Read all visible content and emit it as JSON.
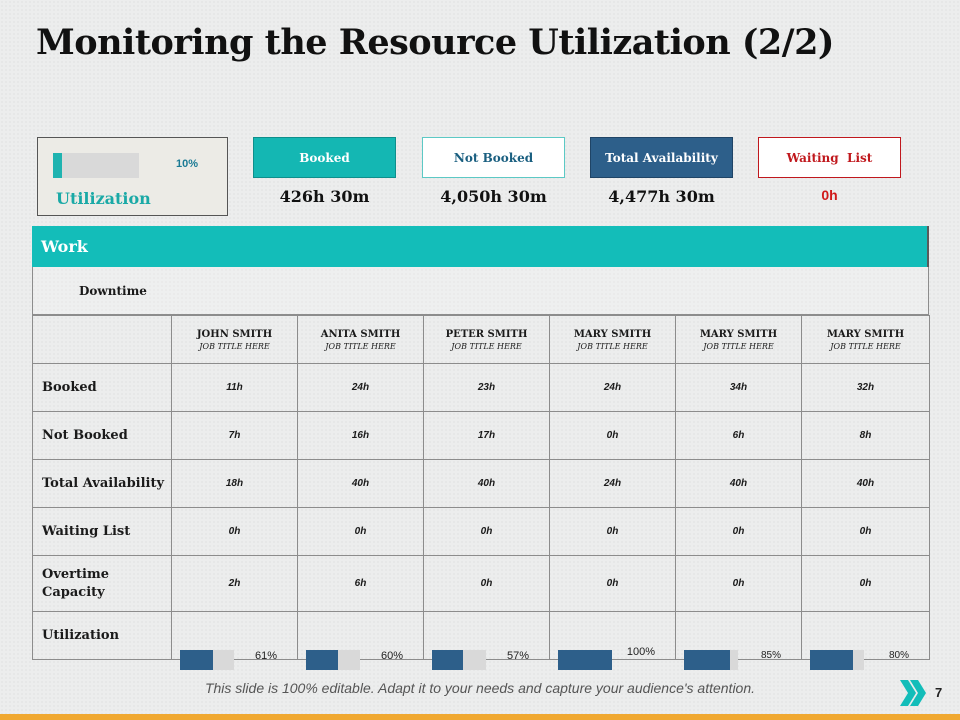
{
  "title": "Monitoring the Resource Utilization (2/2)",
  "summary": {
    "utilization": {
      "label": "Utilization",
      "percent_text": "10%",
      "fraction": 0.1
    },
    "booked": {
      "label": "Booked",
      "value": "426h 30m"
    },
    "not_booked": {
      "label": "Not Booked",
      "value": "4,050h 30m"
    },
    "total_availability": {
      "label": "Total Availability",
      "value": "4,477h 30m"
    },
    "waiting_list": {
      "label": "Waiting  List",
      "value": "0h"
    }
  },
  "table": {
    "section_label": "Work",
    "downtime_label": "Downtime",
    "people": [
      {
        "name": "JOHN SMITH",
        "job": "JOB TITLE HERE"
      },
      {
        "name": "ANITA SMITH",
        "job": "JOB TITLE HERE"
      },
      {
        "name": "PETER SMITH",
        "job": "JOB TITLE HERE"
      },
      {
        "name": "MARY SMITH",
        "job": "JOB TITLE HERE"
      },
      {
        "name": "MARY SMITH",
        "job": "JOB TITLE HERE"
      },
      {
        "name": "MARY SMITH",
        "job": "JOB TITLE HERE"
      }
    ],
    "rows": [
      {
        "label": "Booked",
        "values": [
          "11h",
          "24h",
          "23h",
          "24h",
          "34h",
          "32h"
        ]
      },
      {
        "label": "Not Booked",
        "values": [
          "7h",
          "16h",
          "17h",
          "0h",
          "6h",
          "8h"
        ]
      },
      {
        "label": "Total Availability",
        "values": [
          "18h",
          "40h",
          "40h",
          "24h",
          "40h",
          "40h"
        ]
      },
      {
        "label": "Waiting List",
        "values": [
          "0h",
          "0h",
          "0h",
          "0h",
          "0h",
          "0h"
        ]
      },
      {
        "label": "Overtime Capacity",
        "values": [
          "2h",
          "6h",
          "0h",
          "0h",
          "0h",
          "0h"
        ]
      }
    ],
    "utilization": {
      "label": "Utilization",
      "items": [
        {
          "text": "61%",
          "fraction": 0.61
        },
        {
          "text": "60%",
          "fraction": 0.6
        },
        {
          "text": "57%",
          "fraction": 0.57
        },
        {
          "text": "100%",
          "fraction": 1.0
        },
        {
          "text": "85%",
          "fraction": 0.85
        },
        {
          "text": "80%",
          "fraction": 0.8
        }
      ]
    }
  },
  "footer": {
    "note": "This slide is 100% editable. Adapt it to your needs and capture your audience's attention.",
    "page_number": "7"
  },
  "colors": {
    "teal": "#13bdb9",
    "navy": "#2d5f8a",
    "red": "#c0181d",
    "orange": "#f0a830"
  }
}
